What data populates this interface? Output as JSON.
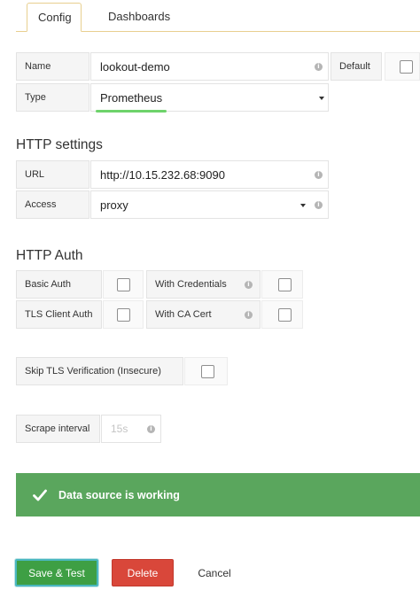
{
  "tabs": [
    {
      "label": "Config",
      "active": true
    },
    {
      "label": "Dashboards",
      "active": false
    }
  ],
  "basic": {
    "name_label": "Name",
    "name_value": "lookout-demo",
    "default_label": "Default",
    "default_checked": false,
    "type_label": "Type",
    "type_value": "Prometheus"
  },
  "http_settings": {
    "heading": "HTTP settings",
    "url_label": "URL",
    "url_value": "http://10.15.232.68:9090",
    "access_label": "Access",
    "access_value": "proxy"
  },
  "http_auth": {
    "heading": "HTTP Auth",
    "basic_auth_label": "Basic Auth",
    "basic_auth_checked": false,
    "with_credentials_label": "With Credentials",
    "with_credentials_checked": false,
    "tls_client_auth_label": "TLS Client Auth",
    "tls_client_auth_checked": false,
    "with_ca_cert_label": "With CA Cert",
    "with_ca_cert_checked": false,
    "skip_tls_label": "Skip TLS Verification (Insecure)",
    "skip_tls_checked": false
  },
  "scrape": {
    "label": "Scrape interval",
    "placeholder": "15s"
  },
  "alert": {
    "message": "Data source is working",
    "color": "#5aa65d"
  },
  "buttons": {
    "save": "Save & Test",
    "delete": "Delete",
    "cancel": "Cancel"
  },
  "icons": {
    "info": "i"
  },
  "colors": {
    "accent_underline": "#6ed36b",
    "save": "#3e9f44",
    "delete": "#d9473a"
  }
}
